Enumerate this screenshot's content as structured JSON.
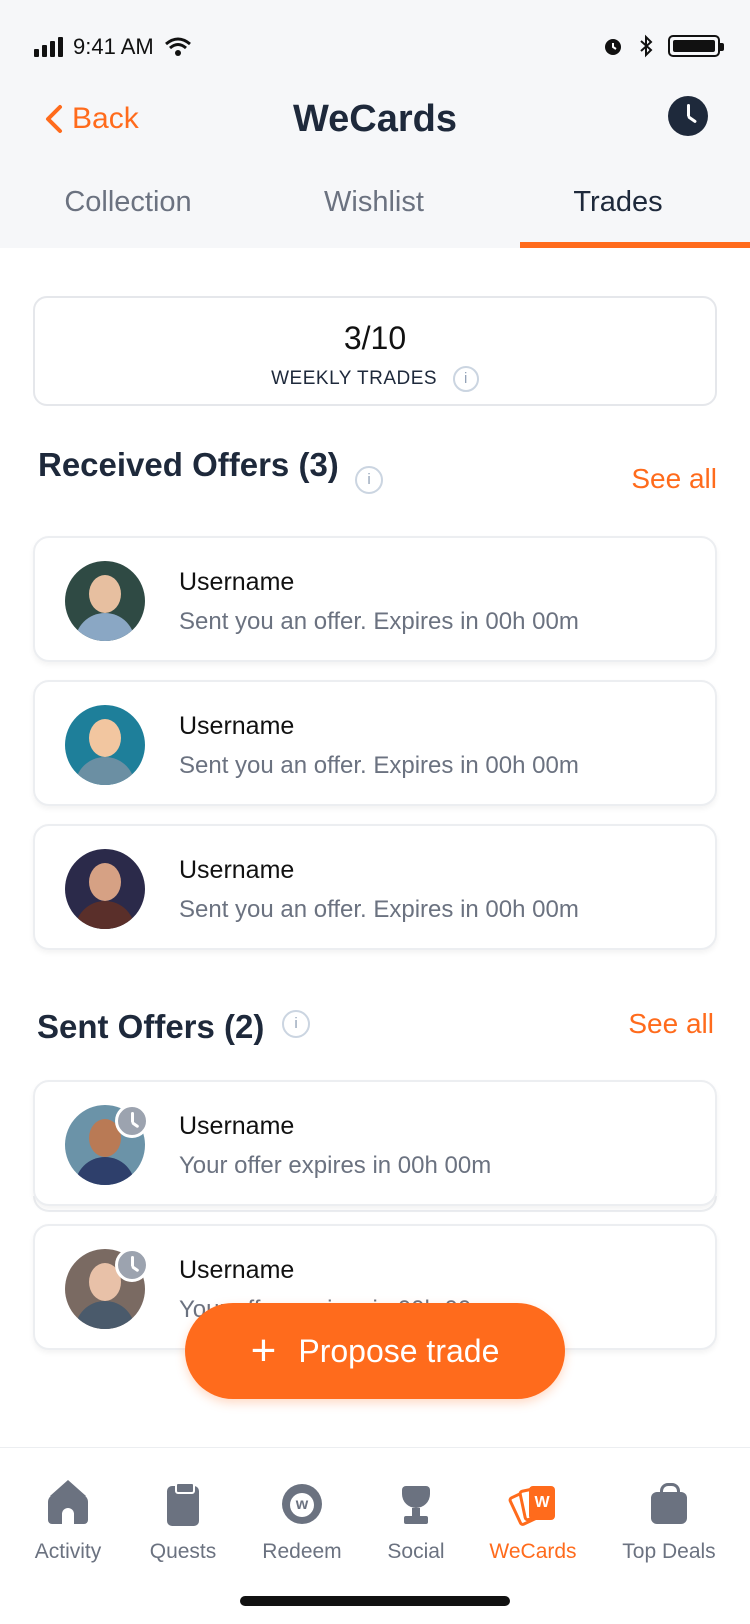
{
  "status_bar": {
    "time": "9:41 AM"
  },
  "header": {
    "back_label": "Back",
    "title": "WeCards"
  },
  "tabs": [
    {
      "label": "Collection",
      "active": false
    },
    {
      "label": "Wishlist",
      "active": false
    },
    {
      "label": "Trades",
      "active": true
    }
  ],
  "weekly_trades": {
    "count": "3/10",
    "label": "WEEKLY TRADES",
    "info_glyph": "i"
  },
  "received": {
    "title": "Received Offers (3)",
    "see_all": "See all",
    "items": [
      {
        "username": "Username",
        "message": "Sent you an offer. Expires in 00h 00m",
        "avatar_colors": [
          "#2f4a44",
          "#e7bfa0",
          "#8aa7c4"
        ]
      },
      {
        "username": "Username",
        "message": "Sent you an offer. Expires in 00h 00m",
        "avatar_colors": [
          "#1e7f9a",
          "#f2c6a0",
          "#6b8fa3"
        ]
      },
      {
        "username": "Username",
        "message": "Sent you an offer. Expires in 00h 00m",
        "avatar_colors": [
          "#2b2a4a",
          "#d6a184",
          "#5a2f2a"
        ]
      }
    ]
  },
  "sent": {
    "title": "Sent Offers (2)",
    "see_all": "See all",
    "items": [
      {
        "username": "Username",
        "message": "Your offer expires in 00h 00m",
        "avatar_colors": [
          "#6b93a8",
          "#b97a55",
          "#2e3f6b"
        ]
      },
      {
        "username": "Username",
        "message": "Your offer expires in 00h 00m",
        "avatar_colors": [
          "#7a6a62",
          "#e8c1a8",
          "#4a5a6b"
        ]
      }
    ]
  },
  "fab": {
    "label": "Propose trade",
    "icon": "plus-icon"
  },
  "bottom_nav": [
    {
      "label": "Activity",
      "icon": "house-icon",
      "active": false
    },
    {
      "label": "Quests",
      "icon": "clipboard-icon",
      "active": false
    },
    {
      "label": "Redeem",
      "icon": "coin-icon",
      "glyph": "w",
      "active": false
    },
    {
      "label": "Social",
      "icon": "trophy-icon",
      "active": false
    },
    {
      "label": "WeCards",
      "icon": "cards-icon",
      "glyph": "W",
      "active": true
    },
    {
      "label": "Top Deals",
      "icon": "bag-icon",
      "active": false
    }
  ],
  "colors": {
    "accent": "#ff6b1c",
    "dark": "#1e293b",
    "muted": "#6b7280"
  }
}
